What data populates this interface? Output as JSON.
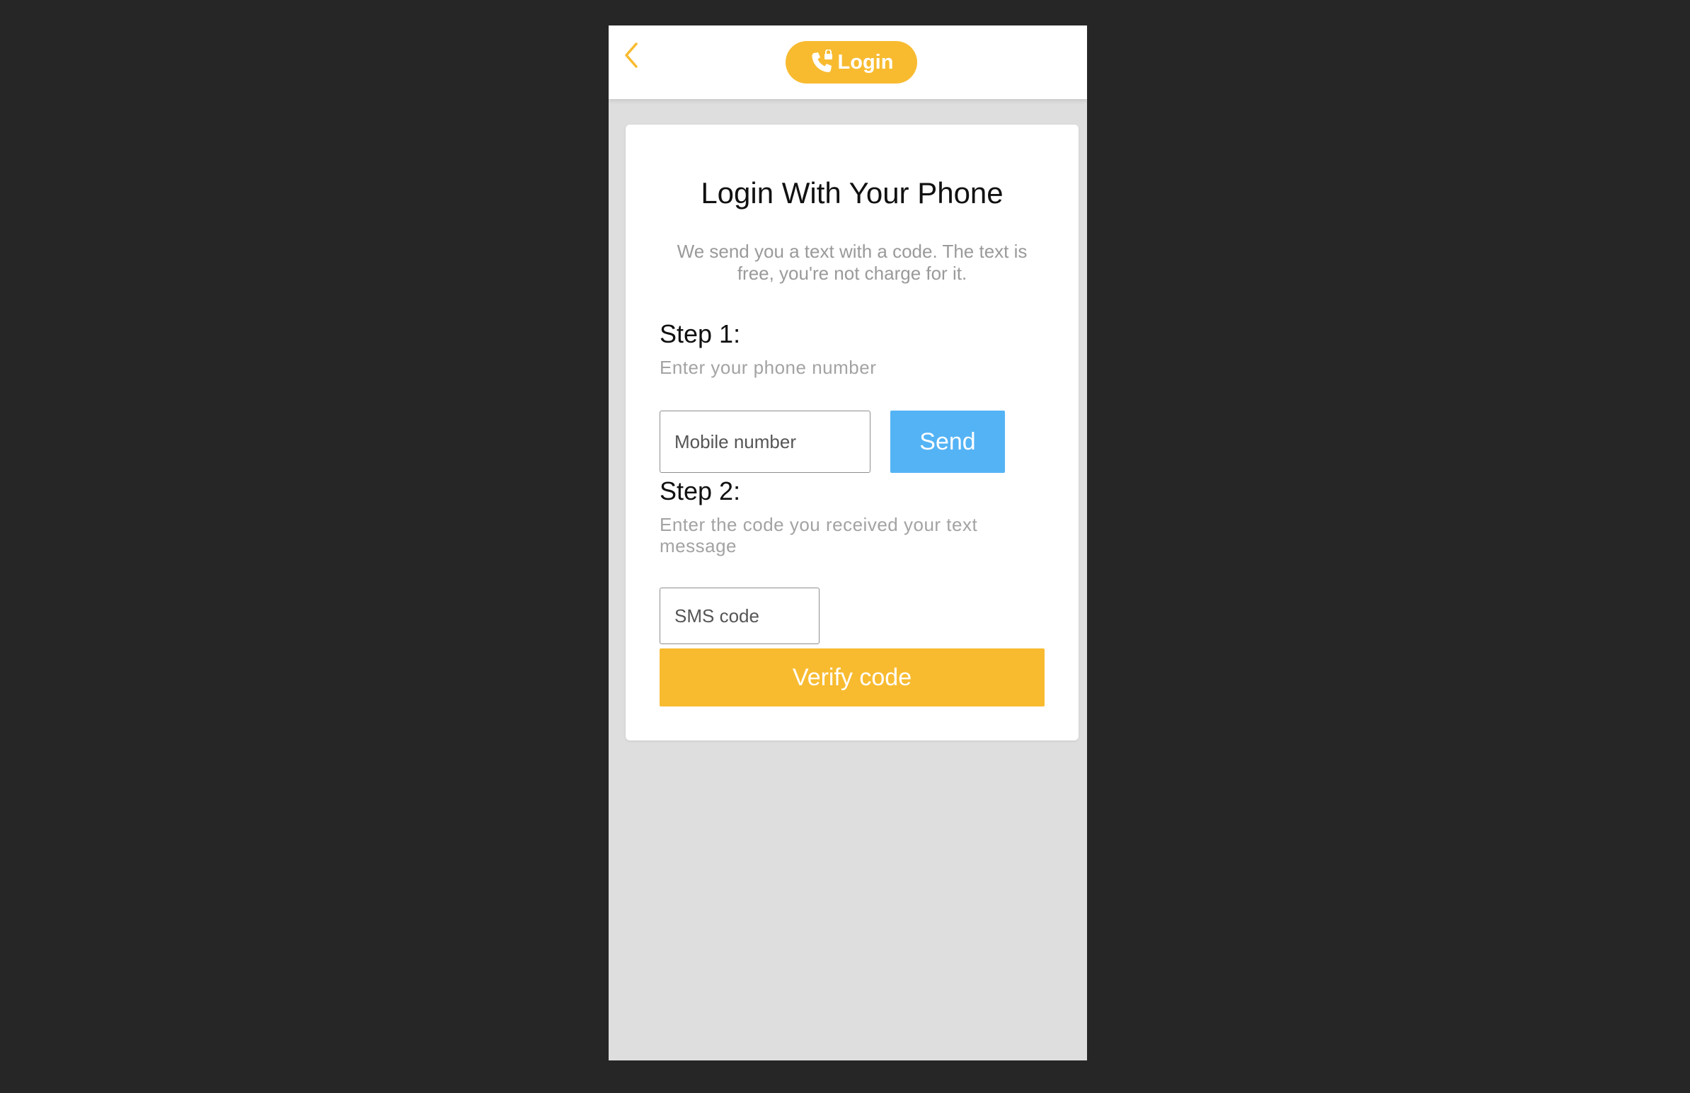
{
  "header": {
    "back_icon": "chevron-left-icon",
    "login_icon": "phone-lock-icon",
    "login_label": "Login"
  },
  "card": {
    "title": "Login With Your Phone",
    "subtitle": "We send you a text with a code. The text is free, you're not charge for it."
  },
  "step1": {
    "title": "Step 1:",
    "hint": "Enter your phone number",
    "input_placeholder": "Mobile number",
    "input_value": "",
    "send_label": "Send"
  },
  "step2": {
    "title": "Step 2:",
    "hint": "Enter the code you received your text message",
    "input_placeholder": "SMS code",
    "input_value": ""
  },
  "verify_label": "Verify code",
  "colors": {
    "accent": "#f8bb30",
    "send_button": "#54b3f5",
    "background": "#dedede",
    "frame": "#262626"
  }
}
